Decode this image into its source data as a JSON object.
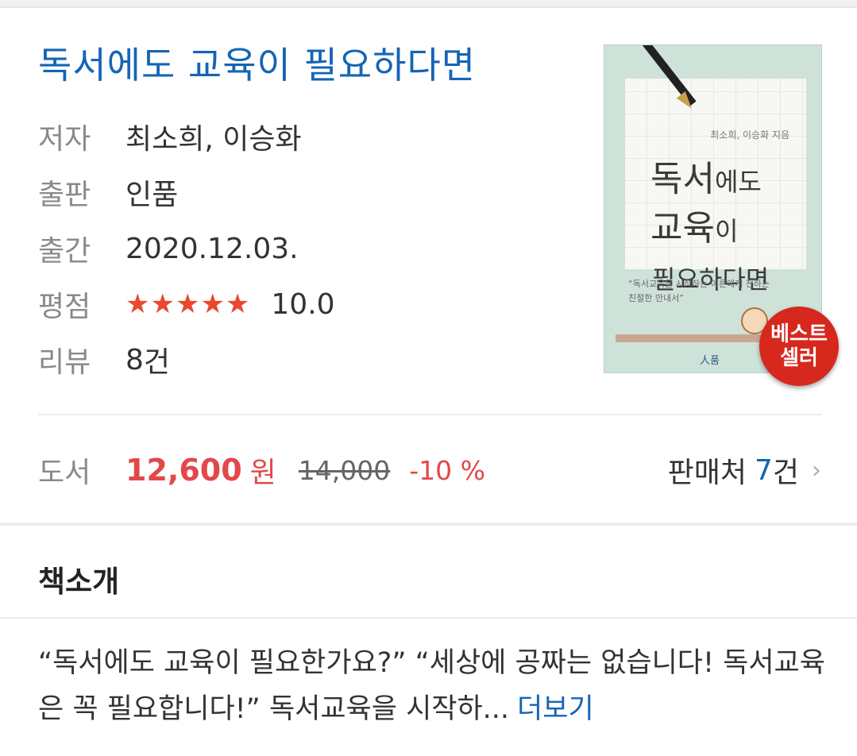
{
  "book": {
    "title": "독서에도 교육이 필요하다면",
    "author_label": "저자",
    "author": "최소희, 이승화",
    "publisher_label": "출판",
    "publisher": "인품",
    "date_label": "출간",
    "date": "2020.12.03.",
    "rating_label": "평점",
    "rating_stars": "★★★★★",
    "rating_value": "10.0",
    "review_label": "리뷰",
    "review_count": "8",
    "review_unit": "건"
  },
  "cover": {
    "author_small": "최소희, 이승화 지음",
    "line1_big": "독서",
    "line1_small": "에도",
    "line2_big": "교육",
    "line2_small": "이",
    "line3": "필요하다면",
    "subtitle": "“독서교육을 시작하는 어른에게 전하는 친절한 안내서”",
    "publisher_mark": "人품",
    "badge_line1": "베스트",
    "badge_line2": "셀러"
  },
  "price": {
    "label": "도서",
    "sale": "12,600",
    "currency": "원",
    "original": "14,000",
    "discount": "-10 %",
    "sellers_label": "판매처",
    "sellers_count": "7",
    "sellers_unit": "건",
    "chevron": "›"
  },
  "intro": {
    "heading": "책소개",
    "text": "“독서에도 교육이 필요한가요?” “세상에 공짜는 없습니다! 독서교육은 꼭 필요합니다!” 독서교육을 시작하...",
    "more": "더보기"
  },
  "colors": {
    "link_blue": "#1565b5",
    "price_red": "#e2484a",
    "star_red": "#e8492f",
    "badge_red": "#d7281d"
  }
}
